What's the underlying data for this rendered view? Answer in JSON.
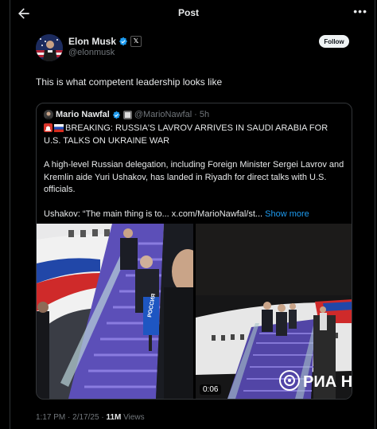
{
  "header": {
    "title": "Post",
    "back_icon": "arrow-left-icon",
    "more_label": "•••"
  },
  "author": {
    "name": "Elon Musk",
    "handle": "@elonmusk",
    "verified": true,
    "affiliate_badge": "𝕏"
  },
  "follow_label": "Follow",
  "post_text": "This is what competent leadership looks like",
  "quoted": {
    "name": "Mario Nawfal",
    "handle": "@MarioNawfal",
    "separator": "·",
    "time": "5h",
    "lines": [
      "BREAKING: RUSSIA'S LAVROV ARRIVES IN SAUDI ARABIA FOR U.S. TALKS ON UKRAINE WAR",
      "A high-level Russian delegation, including Foreign Minister Sergei Lavrov and Kremlin aide Yuri Ushakov, has landed in Riyadh for direct talks with U.S. officials.",
      "Ushakov: “The main thing is to... x.com/MarioNawfal/st..."
    ],
    "show_more": "Show more",
    "media": {
      "left_label": "РОССИЯ",
      "right_watermark": "РИА НО",
      "duration": "0:06"
    }
  },
  "meta": {
    "time": "1:17 PM",
    "sep1": "·",
    "date": "2/17/25",
    "sep2": "·",
    "views_count": "11M",
    "views_label": "Views"
  },
  "colors": {
    "accent": "#1d9bf0",
    "background": "#000000",
    "text": "#e7e9ea",
    "muted": "#71767b"
  }
}
